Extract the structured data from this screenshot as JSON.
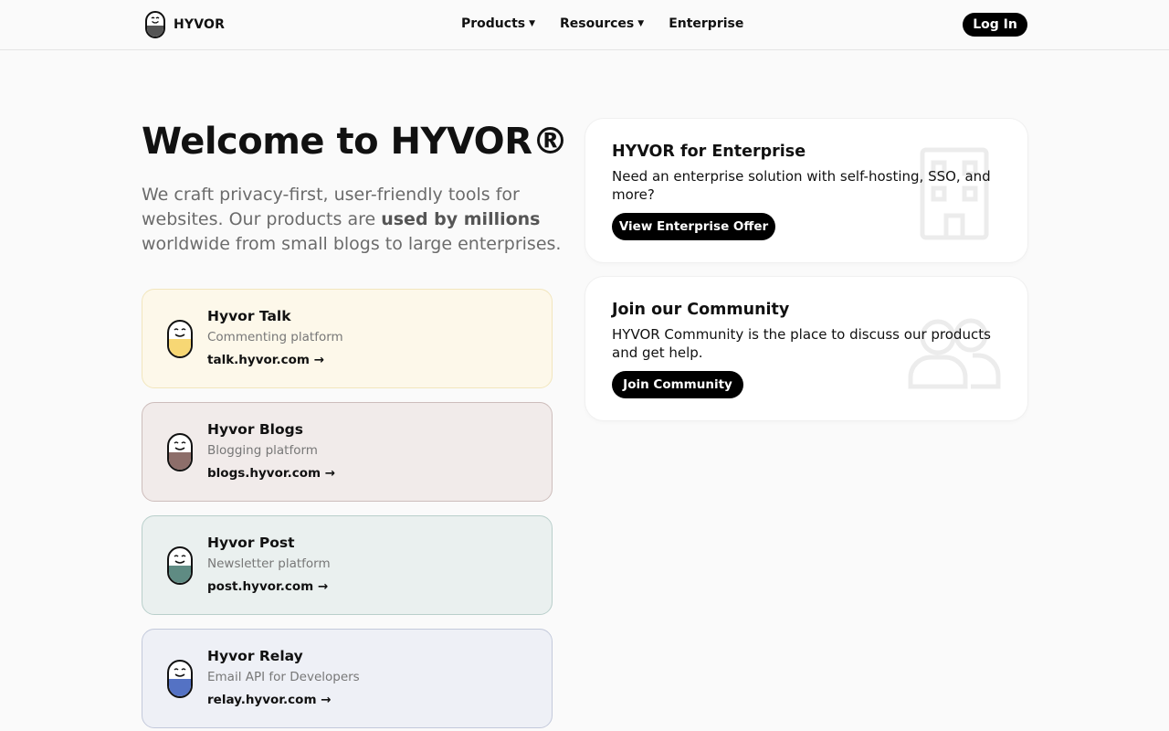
{
  "header": {
    "logo_text": "HYVOR",
    "nav": [
      {
        "label": "Products",
        "has_dropdown": true
      },
      {
        "label": "Resources",
        "has_dropdown": true
      },
      {
        "label": "Enterprise",
        "has_dropdown": false
      }
    ],
    "login_label": "Log In"
  },
  "hero": {
    "title": "Welcome to HYVOR®",
    "subtitle_before": "We craft privacy-first, user-friendly tools for websites. Our products are ",
    "subtitle_bold": "used by millions",
    "subtitle_after": " worldwide from small blogs to large enterprises."
  },
  "products": [
    {
      "name": "Hyvor Talk",
      "description": "Commenting platform",
      "link": "talk.hyvor.com →",
      "color": "#f7d774"
    },
    {
      "name": "Hyvor Blogs",
      "description": "Blogging platform",
      "link": "blogs.hyvor.com →",
      "color": "#8d6e6a"
    },
    {
      "name": "Hyvor Post",
      "description": "Newsletter platform",
      "link": "post.hyvor.com →",
      "color": "#5f8b83"
    },
    {
      "name": "Hyvor Relay",
      "description": "Email API for Developers",
      "link": "relay.hyvor.com →",
      "color": "#5472c4"
    }
  ],
  "enterprise": {
    "title": "HYVOR for Enterprise",
    "text": "Need an enterprise solution with self-hosting, SSO, and more?",
    "button": "View Enterprise Offer",
    "icon": "building-icon"
  },
  "community": {
    "title": "Join our Community",
    "text": "HYVOR Community is the place to discuss our products and get help.",
    "button": "Join Community",
    "icon": "users-icon"
  }
}
